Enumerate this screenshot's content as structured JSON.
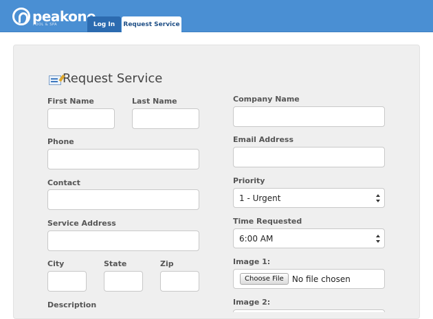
{
  "header": {
    "logo_text": "peakone",
    "logo_sub": "POOL & SPA",
    "tabs": [
      {
        "label": "Log In"
      },
      {
        "label": "Request Service"
      }
    ]
  },
  "form": {
    "title": "Request Service",
    "labels": {
      "first_name": "First Name",
      "last_name": "Last Name",
      "phone": "Phone",
      "contact": "Contact",
      "service_address": "Service Address",
      "city": "City",
      "state": "State",
      "zip": "Zip",
      "description": "Description",
      "company_name": "Company Name",
      "email_address": "Email Address",
      "priority": "Priority",
      "time_requested": "Time Requested",
      "image1": "Image 1:",
      "image2": "Image 2:"
    },
    "priority_value": "1 - Urgent",
    "time_value": "6:00 AM",
    "file_button": "Choose File",
    "file_status": "No file chosen"
  }
}
